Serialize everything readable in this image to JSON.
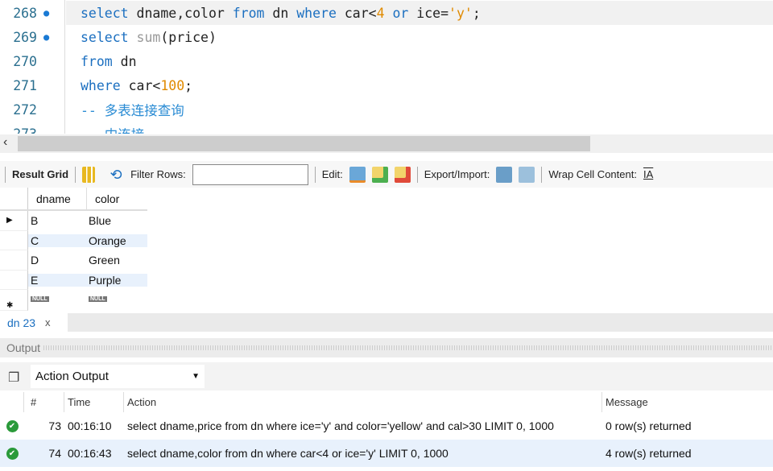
{
  "editor": {
    "lines": [
      {
        "num": "268",
        "marker": true,
        "current": true,
        "tokens": [
          [
            "kw",
            "select"
          ],
          [
            "id",
            " dname,color "
          ],
          [
            "kw",
            "from"
          ],
          [
            "id",
            " dn "
          ],
          [
            "kw",
            "where"
          ],
          [
            "id",
            " car<"
          ],
          [
            "num",
            "4"
          ],
          [
            "id",
            " "
          ],
          [
            "kw",
            "or"
          ],
          [
            "id",
            " ice="
          ],
          [
            "str",
            "'y'"
          ],
          [
            "id",
            ";"
          ]
        ]
      },
      {
        "num": "269",
        "marker": true,
        "tokens": [
          [
            "kw",
            "select"
          ],
          [
            "id",
            " "
          ],
          [
            "fn",
            "sum"
          ],
          [
            "id",
            "(price)"
          ]
        ]
      },
      {
        "num": "270",
        "tokens": [
          [
            "kw",
            "from"
          ],
          [
            "id",
            " dn"
          ]
        ]
      },
      {
        "num": "271",
        "tokens": [
          [
            "kw",
            "where"
          ],
          [
            "id",
            " car<"
          ],
          [
            "num",
            "100"
          ],
          [
            "id",
            ";"
          ]
        ]
      },
      {
        "num": "272",
        "tokens": [
          [
            "cm",
            "-- 多表连接查询"
          ]
        ]
      },
      {
        "num": "273",
        "tokens": [
          [
            "cm",
            "   内连接"
          ]
        ]
      }
    ]
  },
  "toolbar": {
    "result_grid": "Result Grid",
    "filter_label": "Filter Rows:",
    "filter_value": "",
    "edit": "Edit:",
    "export": "Export/Import:",
    "wrap": "Wrap Cell Content:"
  },
  "grid": {
    "columns": [
      "dname",
      "color"
    ],
    "rows": [
      [
        "B",
        "Blue"
      ],
      [
        "C",
        "Orange"
      ],
      [
        "D",
        "Green"
      ],
      [
        "E",
        "Purple"
      ]
    ],
    "null": "NULL"
  },
  "result_tab": {
    "label": "dn 23",
    "close": "x"
  },
  "output": {
    "title": "Output",
    "selector": "Action Output",
    "columns": [
      "#",
      "Time",
      "Action",
      "Message"
    ],
    "rows": [
      {
        "num": "73",
        "time": "00:16:10",
        "action": "select dname,price from dn where ice='y' and color='yellow' and cal>30 LIMIT 0, 1000",
        "message": "0 row(s) returned",
        "status": "success"
      },
      {
        "num": "74",
        "time": "00:16:43",
        "action": "select dname,color from dn where car<4 or ice='y' LIMIT 0, 1000",
        "message": "4 row(s) returned",
        "status": "success"
      }
    ]
  }
}
